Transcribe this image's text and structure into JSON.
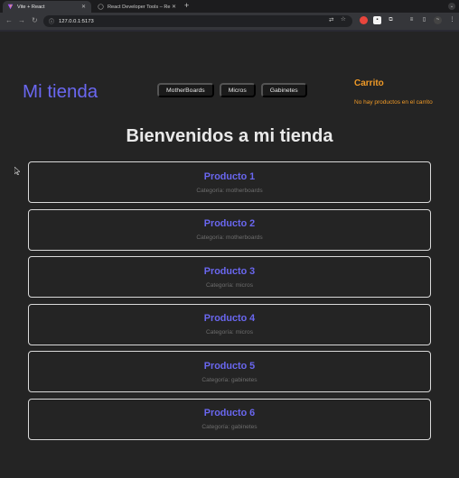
{
  "browser": {
    "tabs": [
      {
        "label": "Vite + React",
        "icon": "vite-icon",
        "active": true
      },
      {
        "label": "React Developer Tools – Re...",
        "icon": "react-devtools-icon",
        "active": false
      }
    ],
    "url": "127.0.0.1:5173"
  },
  "header": {
    "logo": "Mi tienda",
    "nav": [
      "MotherBoards",
      "Micros",
      "Gabinetes"
    ],
    "cart": {
      "title": "Carrito",
      "empty_message": "No hay productos en el carrito"
    }
  },
  "main": {
    "title": "Bienvenidos a mi tienda",
    "products": [
      {
        "name": "Producto 1",
        "category": "Categoría: motherboards"
      },
      {
        "name": "Producto 2",
        "category": "Categoría: motherboards"
      },
      {
        "name": "Producto 3",
        "category": "Categoría: micros"
      },
      {
        "name": "Producto 4",
        "category": "Categoría: micros"
      },
      {
        "name": "Producto 5",
        "category": "Categoría: gabinetes"
      },
      {
        "name": "Producto 6",
        "category": "Categoría: gabinetes"
      }
    ]
  },
  "colors": {
    "accent": "#6a67f0",
    "cart": "#f09a27",
    "background": "#242424"
  }
}
